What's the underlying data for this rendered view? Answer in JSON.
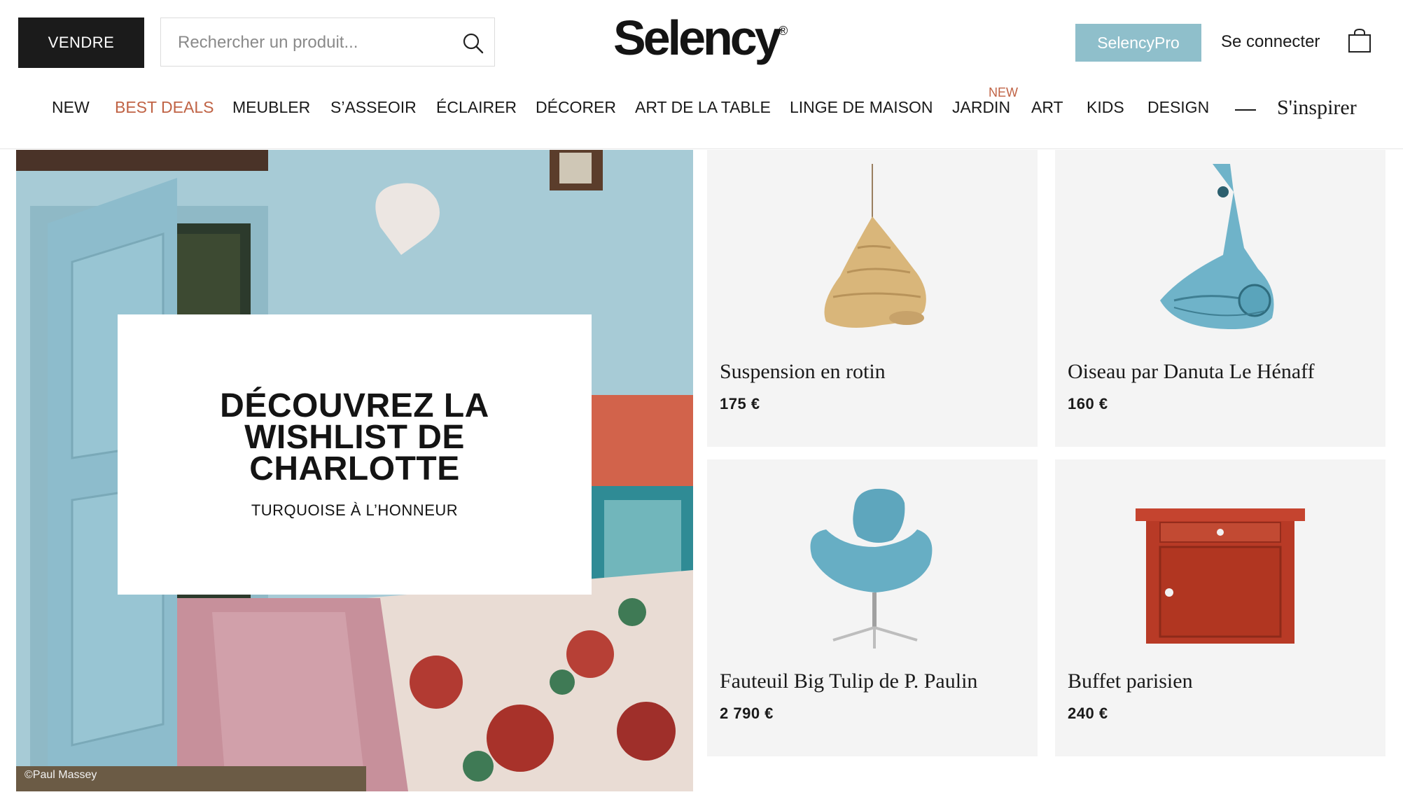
{
  "header": {
    "sell_label": "VENDRE",
    "search_placeholder": "Rechercher un produit...",
    "logo": "Selency",
    "logo_mark": "®",
    "pro_label": "SelencyPro",
    "login_label": "Se connecter"
  },
  "nav": {
    "items": [
      {
        "label": "NEW"
      },
      {
        "label": "BEST DEALS"
      },
      {
        "label": "MEUBLER"
      },
      {
        "label": "S’ASSEOIR"
      },
      {
        "label": "ÉCLAIRER"
      },
      {
        "label": "DÉCORER"
      },
      {
        "label": "ART DE LA TABLE"
      },
      {
        "label": "LINGE DE MAISON"
      },
      {
        "label": "JARDIN",
        "badge": "NEW"
      },
      {
        "label": "ART"
      },
      {
        "label": "KIDS"
      },
      {
        "label": "DESIGN"
      }
    ],
    "inspire_label": "S'inspirer"
  },
  "hero": {
    "title": "DÉCOUVREZ LA WISHLIST DE CHARLOTTE",
    "subtitle": "TURQUOISE À L’HONNEUR",
    "credit": "©Paul Massey"
  },
  "products": [
    {
      "name": "Suspension en rotin",
      "price": "175 €"
    },
    {
      "name": "Oiseau par Danuta Le Hénaff",
      "price": "160 €"
    },
    {
      "name": "Fauteuil Big Tulip de P. Paulin",
      "price": "2 790 €"
    },
    {
      "name": "Buffet parisien",
      "price": "240 €"
    }
  ],
  "colors": {
    "accent": "#c06345",
    "pro_button": "#8fbfcb",
    "dark": "#1b1b1b"
  },
  "icons": {
    "search": "search-icon",
    "cart": "shopping-bag-icon"
  }
}
